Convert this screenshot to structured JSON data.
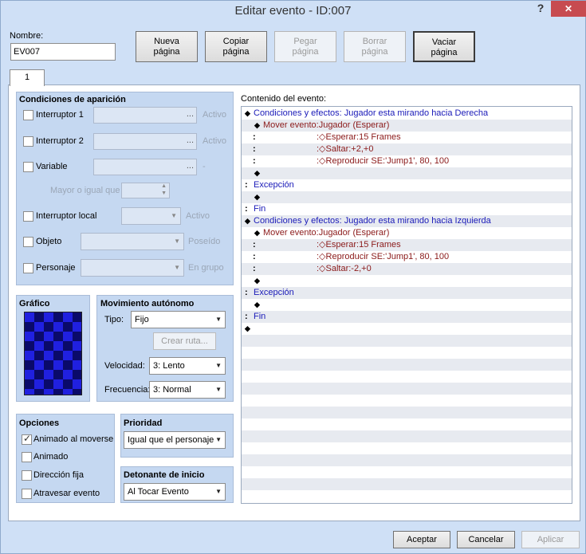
{
  "window": {
    "title": "Editar evento - ID:007",
    "help_glyph": "?",
    "close_glyph": "✕"
  },
  "name": {
    "label": "Nombre:",
    "value": "EV007"
  },
  "toolbar": {
    "new_page": [
      "Nueva",
      "página"
    ],
    "copy_page": [
      "Copiar",
      "página"
    ],
    "paste_page": [
      "Pegar",
      "página"
    ],
    "delete_page": [
      "Borrar",
      "página"
    ],
    "clear_page": [
      "Vaciar",
      "página"
    ]
  },
  "tab": {
    "label": "1"
  },
  "conditions": {
    "title": "Condiciones de aparición",
    "switch1": {
      "label": "Interruptor 1",
      "suffix": "Activo"
    },
    "switch2": {
      "label": "Interruptor 2",
      "suffix": "Activo"
    },
    "variable": {
      "label": "Variable",
      "suffix": "-"
    },
    "greater_equal": "Mayor o igual que",
    "self_switch": {
      "label": "Interruptor local",
      "suffix": "Activo"
    },
    "item": {
      "label": "Objeto",
      "suffix": "Poseído"
    },
    "actor": {
      "label": "Personaje",
      "suffix": "En grupo"
    },
    "dots": "..."
  },
  "graphic": {
    "title": "Gráfico"
  },
  "autonomous": {
    "title": "Movimiento autónomo",
    "type_label": "Tipo:",
    "type_value": "Fijo",
    "route_button": "Crear ruta...",
    "speed_label": "Velocidad:",
    "speed_value": "3: Lento",
    "freq_label": "Frecuencia:",
    "freq_value": "3: Normal"
  },
  "options": {
    "title": "Opciones",
    "items": [
      {
        "label": "Animado al moverse",
        "checked": true
      },
      {
        "label": "Animado",
        "checked": false
      },
      {
        "label": "Dirección fija",
        "checked": false
      },
      {
        "label": "Atravesar evento",
        "checked": false
      }
    ]
  },
  "priority": {
    "title": "Prioridad",
    "value": "Igual que el personaje"
  },
  "trigger": {
    "title": "Detonante de inicio",
    "value": "Al Tocar Evento"
  },
  "contents": {
    "label": "Contenido del evento:",
    "rows": [
      {
        "prefix": "◆",
        "text": "Condiciones y efectos",
        "rest": ": Jugador esta mirando hacia Derecha",
        "indent": 4,
        "color": "#1a1ab8"
      },
      {
        "prefix": "◆",
        "text": "Mover evento:Jugador (Esperar)",
        "rest": "",
        "indent": 16,
        "color": "#8b1a1a"
      },
      {
        "prefix": ":",
        "text": "",
        "rest": ":◇Esperar:15 Frames",
        "indent": 14,
        "color": "#8b1a1a"
      },
      {
        "prefix": ":",
        "text": "",
        "rest": ":◇Saltar:+2,+0",
        "indent": 14,
        "color": "#8b1a1a"
      },
      {
        "prefix": ":",
        "text": "",
        "rest": ":◇Reproducir SE:'Jump1', 80, 100",
        "indent": 14,
        "color": "#8b1a1a"
      },
      {
        "prefix": "◆",
        "text": "",
        "rest": "",
        "indent": 16,
        "color": "#000"
      },
      {
        "prefix": ":",
        "text": "Excepción",
        "rest": "",
        "indent": 4,
        "color": "#1a1ab8"
      },
      {
        "prefix": "◆",
        "text": "",
        "rest": "",
        "indent": 16,
        "color": "#000"
      },
      {
        "prefix": ":",
        "text": "Fin",
        "rest": "",
        "indent": 4,
        "color": "#1a1ab8"
      },
      {
        "prefix": "◆",
        "text": "Condiciones y efectos",
        "rest": ": Jugador esta mirando hacia Izquierda",
        "indent": 4,
        "color": "#1a1ab8"
      },
      {
        "prefix": "◆",
        "text": "Mover evento:Jugador (Esperar)",
        "rest": "",
        "indent": 16,
        "color": "#8b1a1a"
      },
      {
        "prefix": ":",
        "text": "",
        "rest": ":◇Esperar:15 Frames",
        "indent": 14,
        "color": "#8b1a1a"
      },
      {
        "prefix": ":",
        "text": "",
        "rest": ":◇Reproducir SE:'Jump1', 80, 100",
        "indent": 14,
        "color": "#8b1a1a"
      },
      {
        "prefix": ":",
        "text": "",
        "rest": ":◇Saltar:-2,+0",
        "indent": 14,
        "color": "#8b1a1a"
      },
      {
        "prefix": "◆",
        "text": "",
        "rest": "",
        "indent": 16,
        "color": "#000"
      },
      {
        "prefix": ":",
        "text": "Excepción",
        "rest": "",
        "indent": 4,
        "color": "#1a1ab8"
      },
      {
        "prefix": "◆",
        "text": "",
        "rest": "",
        "indent": 16,
        "color": "#000"
      },
      {
        "prefix": ":",
        "text": "Fin",
        "rest": "",
        "indent": 4,
        "color": "#1a1ab8"
      },
      {
        "prefix": "◆",
        "text": "",
        "rest": "",
        "indent": 4,
        "color": "#000"
      }
    ]
  },
  "footer": {
    "ok": "Aceptar",
    "cancel": "Cancelar",
    "apply": "Aplicar"
  }
}
